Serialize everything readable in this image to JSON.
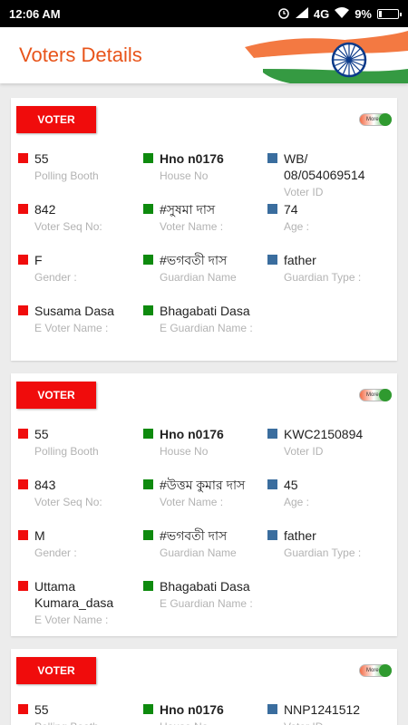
{
  "status": {
    "time": "12:06 AM",
    "network": "4G",
    "battery": "9%"
  },
  "appbar": {
    "title": "Voters Details"
  },
  "cards": [
    {
      "button": "VOTER",
      "toggle": "More",
      "fields": [
        {
          "value": "55",
          "label": "Polling Booth",
          "color": "red",
          "bold": false
        },
        {
          "value": "Hno n0176",
          "label": "House No",
          "color": "green",
          "bold": true
        },
        {
          "value": "WB/\n08/054069514",
          "label": "Voter ID",
          "color": "blue",
          "bold": false
        },
        {
          "value": "842",
          "label": "Voter Seq No:",
          "color": "red",
          "bold": false
        },
        {
          "value": "#সুষমা দাস",
          "label": "Voter Name :",
          "color": "green",
          "bold": false
        },
        {
          "value": "74",
          "label": "Age :",
          "color": "blue",
          "bold": false
        },
        {
          "value": "F",
          "label": "Gender :",
          "color": "red",
          "bold": false
        },
        {
          "value": "#ভগবতী দাস",
          "label": "Guardian Name",
          "color": "green",
          "bold": false
        },
        {
          "value": "father",
          "label": "Guardian Type :",
          "color": "blue",
          "bold": false
        },
        {
          "value": "Susama Dasa",
          "label": "E Voter Name :",
          "color": "red",
          "bold": false
        },
        {
          "value": "Bhagabati Dasa",
          "label": "E Guardian Name :",
          "color": "green",
          "bold": false
        }
      ]
    },
    {
      "button": "VOTER",
      "toggle": "More",
      "fields": [
        {
          "value": "55",
          "label": "Polling Booth",
          "color": "red",
          "bold": false
        },
        {
          "value": "Hno n0176",
          "label": "House No",
          "color": "green",
          "bold": true
        },
        {
          "value": "KWC2150894",
          "label": "Voter ID",
          "color": "blue",
          "bold": false
        },
        {
          "value": "843",
          "label": "Voter Seq No:",
          "color": "red",
          "bold": false
        },
        {
          "value": "#উত্তম কুমার দাস",
          "label": "Voter Name :",
          "color": "green",
          "bold": false
        },
        {
          "value": "45",
          "label": "Age :",
          "color": "blue",
          "bold": false
        },
        {
          "value": "M",
          "label": "Gender :",
          "color": "red",
          "bold": false
        },
        {
          "value": "#ভগবতী দাস",
          "label": "Guardian Name",
          "color": "green",
          "bold": false
        },
        {
          "value": "father",
          "label": "Guardian Type :",
          "color": "blue",
          "bold": false
        },
        {
          "value": "Uttama\nKumara_dasa",
          "label": "E Voter Name :",
          "color": "red",
          "bold": false
        },
        {
          "value": "Bhagabati Dasa",
          "label": "E Guardian Name :",
          "color": "green",
          "bold": false
        }
      ]
    },
    {
      "button": "VOTER",
      "toggle": "More",
      "fields": [
        {
          "value": "55",
          "label": "Polling Booth",
          "color": "red",
          "bold": false
        },
        {
          "value": "Hno n0176",
          "label": "House No",
          "color": "green",
          "bold": true
        },
        {
          "value": "NNP1241512",
          "label": "Voter ID",
          "color": "blue",
          "bold": false
        }
      ]
    }
  ]
}
